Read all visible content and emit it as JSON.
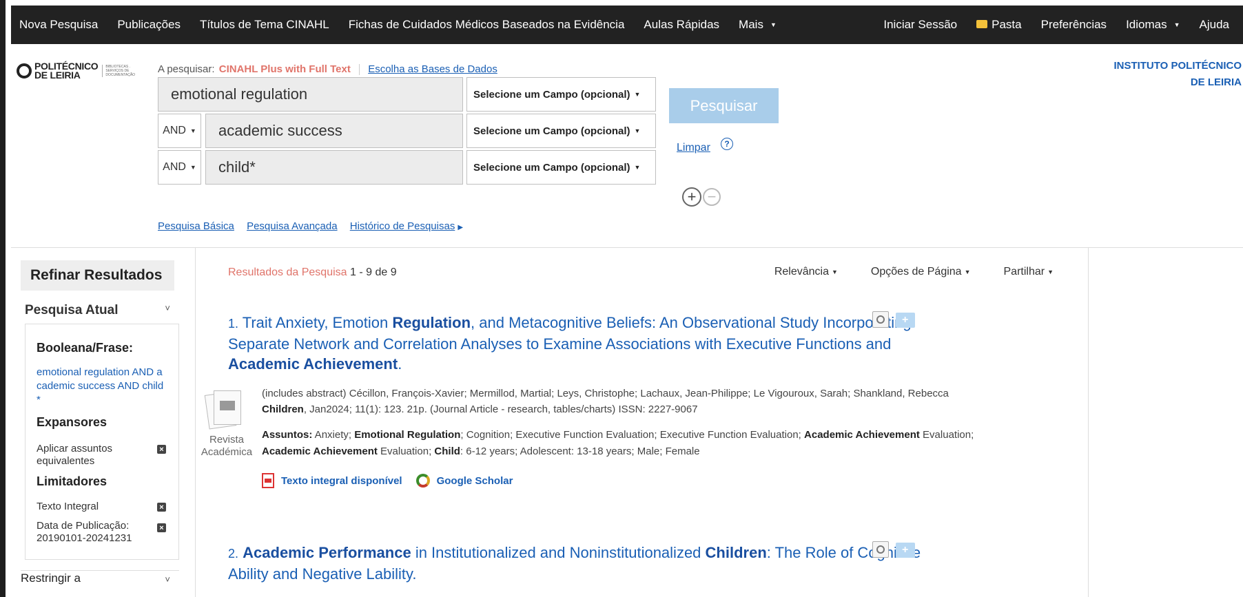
{
  "topnav": {
    "left": [
      "Nova Pesquisa",
      "Publicações",
      "Títulos de Tema CINAHL",
      "Fichas de Cuidados Médicos Baseados na Evidência",
      "Aulas Rápidas",
      "Mais"
    ],
    "right": [
      "Iniciar Sessão",
      "Pasta",
      "Preferências",
      "Idiomas",
      "Ajuda"
    ]
  },
  "header": {
    "logo_main": "POLITÉCNICO\nDE LEIRIA",
    "logo_sub": "BIBLIOTECAS . SERVIÇOS DE DOCUMENTAÇÃO",
    "searching_label": "A pesquisar:",
    "database": "CINAHL Plus with Full Text",
    "choose_db": "Escolha as Bases de Dados",
    "institution_line1": "INSTITUTO POLITÉCNICO",
    "institution_line2": "DE LEIRIA"
  },
  "search": {
    "rows": [
      {
        "op": "",
        "term": "emotional regulation",
        "field": "Selecione um Campo (opcional)"
      },
      {
        "op": "AND",
        "term": "academic success",
        "field": "Selecione um Campo (opcional)"
      },
      {
        "op": "AND",
        "term": "child*",
        "field": "Selecione um Campo (opcional)"
      }
    ],
    "search_button": "Pesquisar",
    "clear": "Limpar",
    "help": "?",
    "links": [
      "Pesquisa Básica",
      "Pesquisa Avançada",
      "Histórico de Pesquisas"
    ]
  },
  "sidebar": {
    "refine": "Refinar Resultados",
    "current": "Pesquisa Atual",
    "boolean_label": "Booleana/Frase:",
    "boolean_value": "emotional regulation AND academic success AND child*",
    "expanders": "Expansores",
    "expander_item": "Aplicar assuntos equivalentes",
    "limiters": "Limitadores",
    "limiter_fulltext": "Texto Integral",
    "limiter_date": "Data de Publicação: 20190101-20241231",
    "restrict": "Restringir a"
  },
  "results": {
    "label": "Resultados da Pesquisa",
    "count": "1 - 9 de 9",
    "options": [
      "Relevância",
      "Opções de Página",
      "Partilhar"
    ],
    "items": [
      {
        "num": "1.",
        "title_parts": [
          "Trait Anxiety, Emotion ",
          "Regulation",
          ", and Metacognitive Beliefs: An Observational Study Incorporating Separate Network and Correlation Analyses to Examine Associations with Executive Functions and ",
          "Academic Achievement",
          "."
        ],
        "authors": "(includes abstract) Cécillon, François-Xavier; Mermillod, Martial; Leys, Christophe; Lachaux, Jean-Philippe; Le Vigouroux, Sarah; Shankland, Rebecca",
        "journal": "Children",
        "journal_rest": ", Jan2024; 11(1): 123. 21p. (Journal Article - research, tables/charts) ISSN: 2227-9067",
        "subjects_label": "Assuntos:",
        "doctype": "Revista Académica",
        "fulltext": "Texto integral disponível",
        "scholar": "Google Scholar"
      },
      {
        "num": "2.",
        "title_parts": [
          "Academic Performance",
          " in Institutionalized and Noninstitutionalized ",
          "Children",
          ": The Role of Cognitive Ability and Negative Lability."
        ]
      }
    ],
    "subjects": [
      {
        "t": " Anxiety; ",
        "b": false
      },
      {
        "t": "Emotional Regulation",
        "b": true
      },
      {
        "t": "; Cognition; Executive Function Evaluation; Executive Function Evaluation; ",
        "b": false
      },
      {
        "t": "Academic Achievement",
        "b": true
      },
      {
        "t": " Evaluation; ",
        "b": false
      },
      {
        "t": "Academic Achievement",
        "b": true
      },
      {
        "t": " Evaluation; ",
        "b": false
      },
      {
        "t": "Child",
        "b": true
      },
      {
        "t": ": 6-12 years; Adolescent: 13-18 years; Male; Female",
        "b": false
      }
    ]
  }
}
